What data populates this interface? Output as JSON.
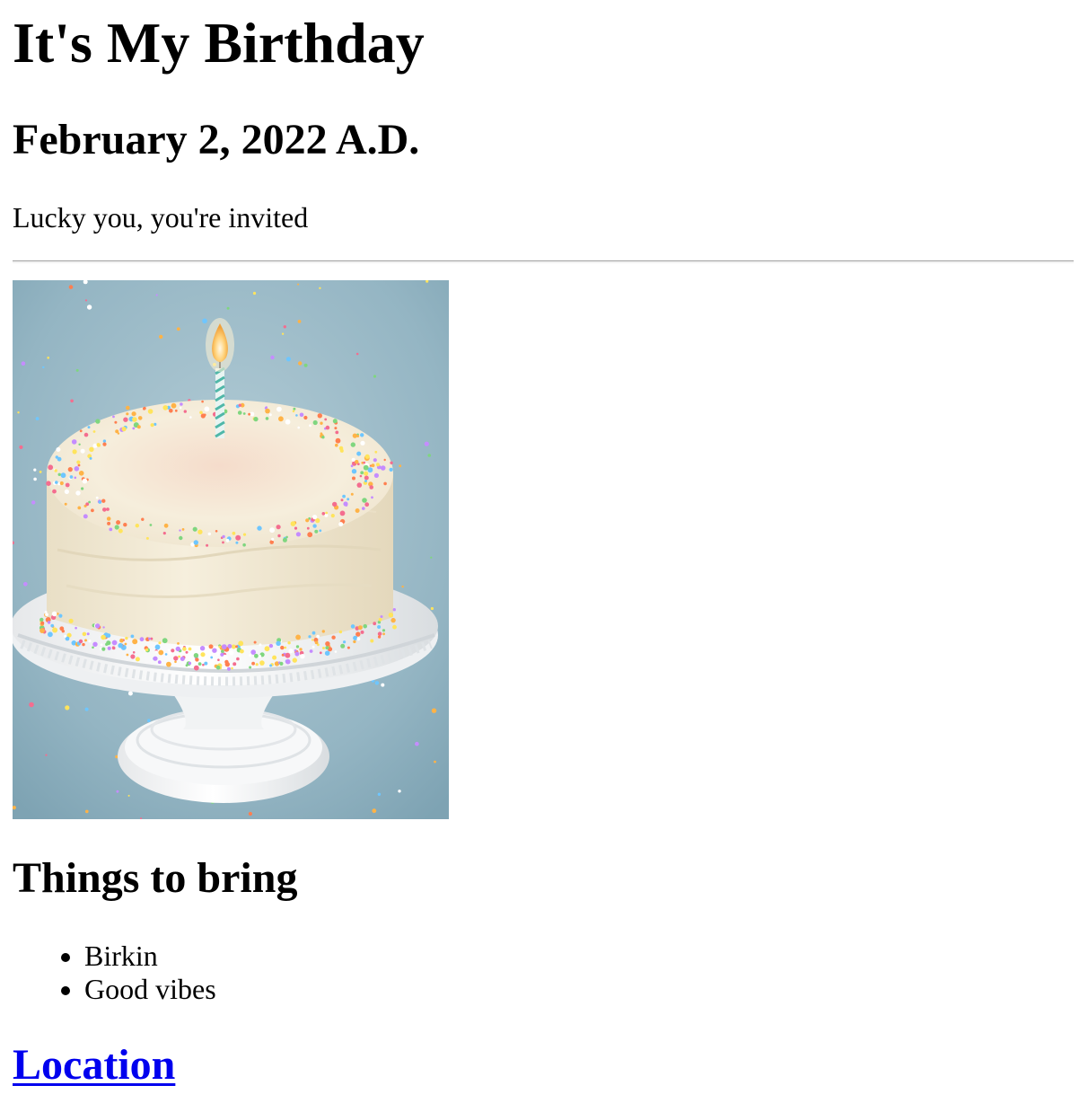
{
  "header": {
    "title": "It's My Birthday",
    "date": "February 2, 2022 A.D.",
    "tagline": "Lucky you, you're invited"
  },
  "image": {
    "subject": "cake-with-candle-image",
    "colors": {
      "background": "#8fb3c2",
      "frosting": "#f3ead6",
      "stand": "#f5f5f5",
      "candle_flame": "#ffd27a"
    }
  },
  "things_to_bring": {
    "heading": "Things to bring",
    "items": [
      "Birkin",
      "Good vibes"
    ]
  },
  "location": {
    "link_text": "Location",
    "link_color": "#0000ee"
  }
}
